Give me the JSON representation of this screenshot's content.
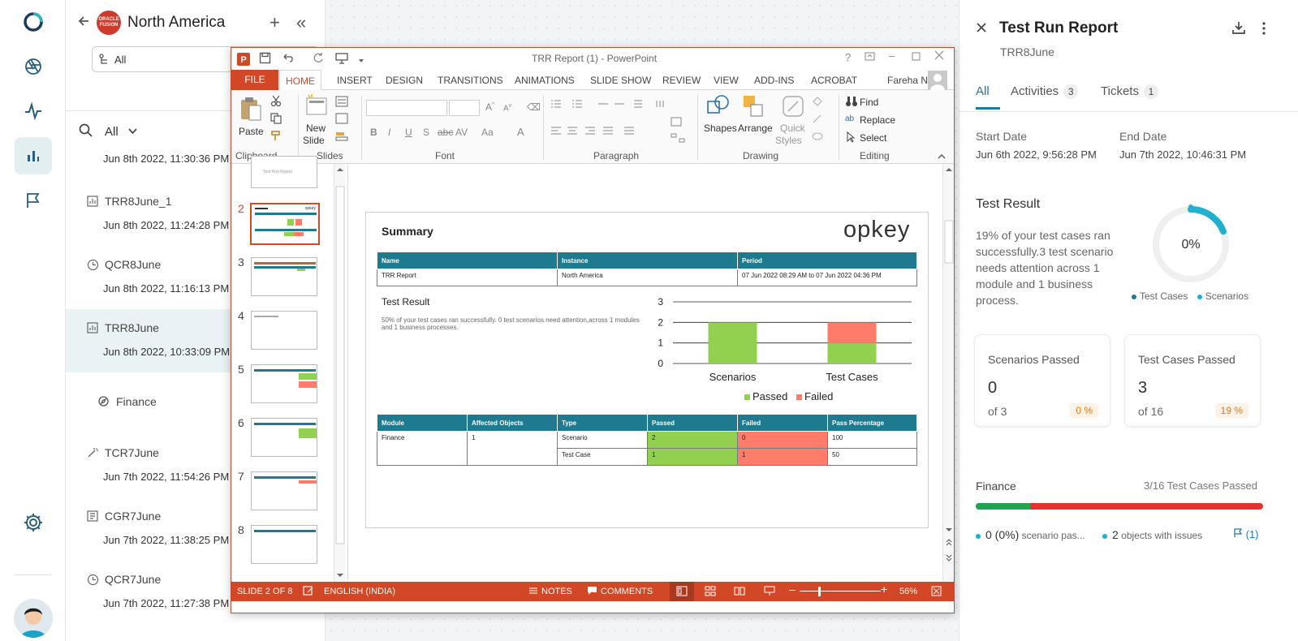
{
  "list_panel": {
    "region_logo_text": "ORACLE FUSION",
    "region_title": "North America",
    "plus_label": "+",
    "collapse_label": "«",
    "filter_value": "All",
    "search_filter": "All",
    "partial_date": "Jun 8th 2022, 11:30:36 PM",
    "items": [
      {
        "name": "TRR8June_1",
        "date": "Jun 8th 2022, 11:24:28 PM"
      },
      {
        "name": "QCR8June",
        "date": "Jun 8th 2022, 11:16:13 PM"
      },
      {
        "name": "TRR8June",
        "date": "Jun 8th 2022, 10:33:09 PM"
      },
      {
        "name": "Finance"
      },
      {
        "name": "TCR7June",
        "date": "Jun 7th 2022, 11:54:26 PM"
      },
      {
        "name": "CGR7June",
        "date": "Jun 7th 2022, 11:38:25 PM"
      },
      {
        "name": "QCR7June",
        "date": "Jun 7th 2022, 11:27:38 PM"
      }
    ]
  },
  "ppt": {
    "window_title": "TRR Report (1) - PowerPoint",
    "user": "Fareha N...",
    "tabs": {
      "file": "FILE",
      "home": "HOME",
      "insert": "INSERT",
      "design": "DESIGN",
      "transitions": "TRANSITIONS",
      "animations": "ANIMATIONS",
      "slideshow": "SLIDE SHOW",
      "review": "REVIEW",
      "view": "VIEW",
      "addins": "ADD-INS",
      "acrobat": "ACROBAT"
    },
    "ribbon": {
      "paste": "Paste",
      "new_slide_1": "New",
      "new_slide_2": "Slide",
      "shapes": "Shapes",
      "arrange": "Arrange",
      "quick_styles_1": "Quick",
      "quick_styles_2": "Styles",
      "find": "Find",
      "replace": "Replace",
      "select": "Select",
      "groups": {
        "clipboard": "Clipboard",
        "slides": "Slides",
        "font": "Font",
        "paragraph": "Paragraph",
        "drawing": "Drawing",
        "editing": "Editing"
      }
    },
    "thumb_numbers": [
      "2",
      "3",
      "4",
      "5",
      "6",
      "7",
      "8"
    ],
    "thumb_text": {
      "first": "Test Run Report",
      "brand": "opkey"
    },
    "status": {
      "slide": "SLIDE 2 OF 8",
      "language": "ENGLISH (INDIA)",
      "notes": "NOTES",
      "comments": "COMMENTS",
      "zoom": "56%"
    },
    "slide": {
      "title": "Summary",
      "brand": "opkey",
      "header_table": {
        "headers": [
          "Name",
          "Instance",
          "Period"
        ],
        "row": [
          "TRR Report",
          "North America",
          "07 Jun 2022 08:29 AM to 07 Jun 2022 04:36 PM"
        ]
      },
      "test_result_title": "Test Result",
      "test_result_desc": "50% of your test cases ran successfully. 0 test scenarios need attention,across 1 modules and 1 business processes.",
      "module_table": {
        "headers": [
          "Module",
          "Affected Objects",
          "Type",
          "Passed",
          "Failed",
          "Pass Percentage"
        ],
        "module": "Finance",
        "affected": "1",
        "rows": [
          {
            "type": "Scenario",
            "passed": "2",
            "failed": "0",
            "pct": "100"
          },
          {
            "type": "Test Case",
            "passed": "1",
            "failed": "1",
            "pct": "50"
          }
        ]
      }
    }
  },
  "chart_data": {
    "type": "bar",
    "stacked": true,
    "categories": [
      "Scenarios",
      "Test Cases"
    ],
    "series": [
      {
        "name": "Passed",
        "color": "#92d050",
        "values": [
          2,
          1
        ]
      },
      {
        "name": "Failed",
        "color": "#ff7c6b",
        "values": [
          0,
          1
        ]
      }
    ],
    "ylim": [
      0,
      3
    ],
    "yticks": [
      "0",
      "1",
      "2",
      "3"
    ],
    "grid": true,
    "legend": "bottom"
  },
  "report": {
    "title": "Test Run Report",
    "subtitle": "TRR8June",
    "tabs": [
      {
        "label": "All"
      },
      {
        "label": "Activities",
        "count": "3"
      },
      {
        "label": "Tickets",
        "count": "1"
      }
    ],
    "start_label": "Start Date",
    "start_value": "Jun 6th 2022, 9:56:28 PM",
    "end_label": "End Date",
    "end_value": "Jun 7th 2022, 10:46:31 PM",
    "test_result_title": "Test Result",
    "test_result_desc": "19% of your test cases ran successfully.3 test scenario needs attention across 1 module and 1 business process.",
    "gauge_value": "0%",
    "gauge_fraction": 0.19,
    "legend_cases": "Test Cases",
    "legend_scenarios": "Scenarios",
    "cards": [
      {
        "title": "Scenarios Passed",
        "value": "0",
        "of": "of 3",
        "pct": "0 %"
      },
      {
        "title": "Test Cases Passed",
        "value": "3",
        "of": "of 16",
        "pct": "19 %"
      }
    ],
    "finance": {
      "title": "Finance",
      "count": "3/16 Test Cases Passed",
      "pass_fraction": 0.19,
      "scenario_value": "0 (0%)",
      "scenario_text": "scenario pas...",
      "objects_value": "2",
      "objects_text": "objects with issues",
      "flag_text": "(1)"
    },
    "colors": {
      "accent": "#1d7a9a",
      "pass": "#20a352",
      "fail": "#e5322d",
      "gauge": "#20b0d0"
    }
  }
}
